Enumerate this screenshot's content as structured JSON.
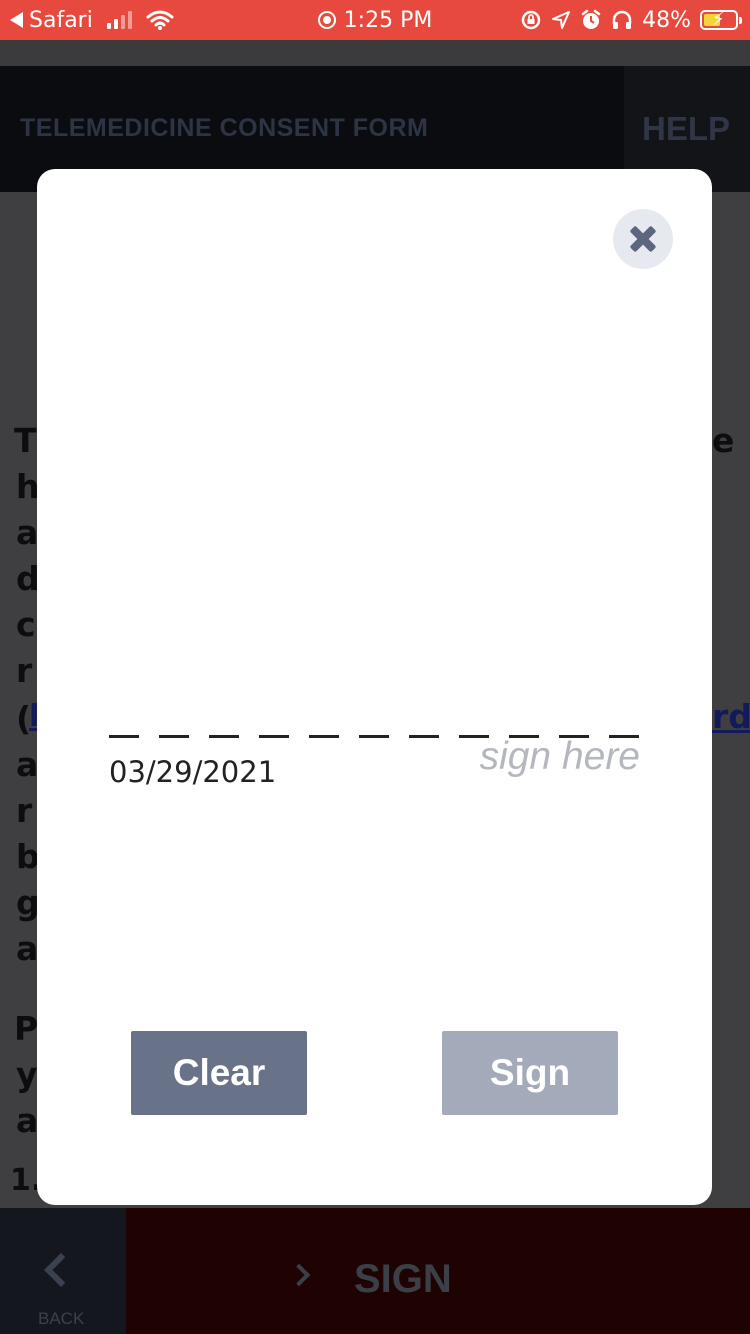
{
  "status_bar": {
    "back_app": "Safari",
    "time": "1:25 PM",
    "battery_percent": "48%",
    "battery_level": 0.48,
    "colors": {
      "background": "#e8493e",
      "text": "#ffffff"
    },
    "icons": [
      "back-arrow-icon",
      "cellular-signal-icon",
      "wifi-icon",
      "screen-recording-icon",
      "rotation-lock-icon",
      "location-arrow-icon",
      "alarm-icon",
      "headphones-icon",
      "battery-charging-icon"
    ]
  },
  "header": {
    "title": "TELEMEDICINE CONSENT FORM",
    "help_label": "HELP"
  },
  "background_content": {
    "left_letters": [
      "T",
      "h",
      "a",
      "d",
      "c",
      "r",
      "(",
      "a",
      "r",
      "b",
      "g",
      "a",
      "P",
      "y",
      "a",
      "1."
    ],
    "right_fragments": [
      "e",
      "rds"
    ],
    "link_fragment": "l"
  },
  "modal": {
    "date": "03/29/2021",
    "sign_hint": "sign here",
    "clear_label": "Clear",
    "sign_label": "Sign",
    "colors": {
      "clear_button": "#687289",
      "sign_button_disabled": "#a3aab9",
      "close_button_bg": "#e6e9f0"
    }
  },
  "bottom_bar": {
    "back_label": "BACK",
    "sign_label": "SIGN"
  }
}
